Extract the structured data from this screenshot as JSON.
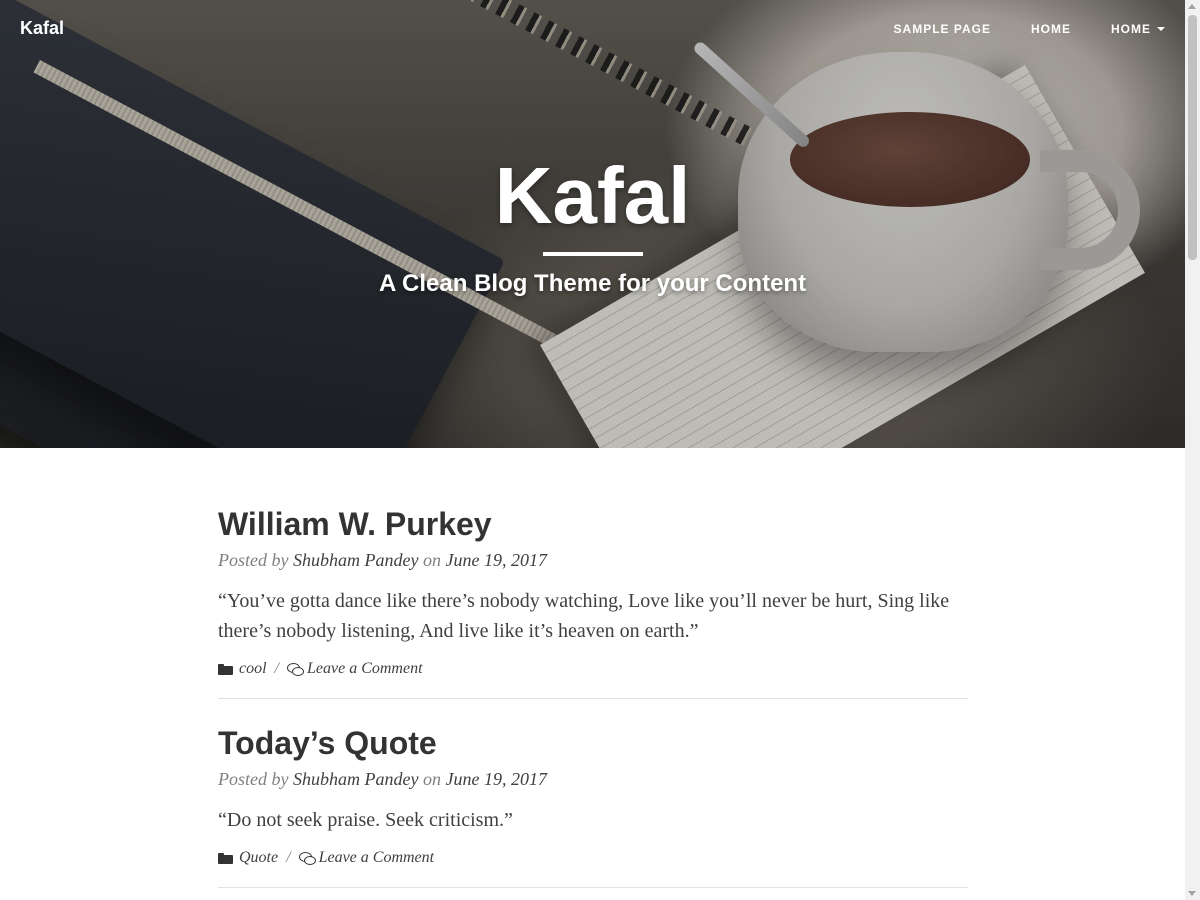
{
  "navbar": {
    "brand": "Kafal",
    "links": [
      {
        "label": "SAMPLE PAGE"
      },
      {
        "label": "HOME"
      },
      {
        "label": "HOME",
        "has_dropdown": true
      }
    ]
  },
  "hero": {
    "title": "Kafal",
    "subtitle": "A Clean Blog Theme for your Content"
  },
  "posts": [
    {
      "title": "William W. Purkey",
      "meta_prefix": "Posted by",
      "author": "Shubham Pandey",
      "meta_on": "on",
      "date": "June 19, 2017",
      "excerpt": "“You’ve gotta dance like there’s nobody watching, Love like you’ll never be hurt, Sing like there’s nobody listening, And live like it’s heaven on earth.”",
      "category": "cool",
      "separator": "/",
      "comment_link": "Leave a Comment"
    },
    {
      "title": "Today’s Quote",
      "meta_prefix": "Posted by",
      "author": "Shubham Pandey",
      "meta_on": "on",
      "date": "June 19, 2017",
      "excerpt": "“Do not seek praise. Seek criticism.”",
      "category": "Quote",
      "separator": "/",
      "comment_link": "Leave a Comment"
    }
  ]
}
